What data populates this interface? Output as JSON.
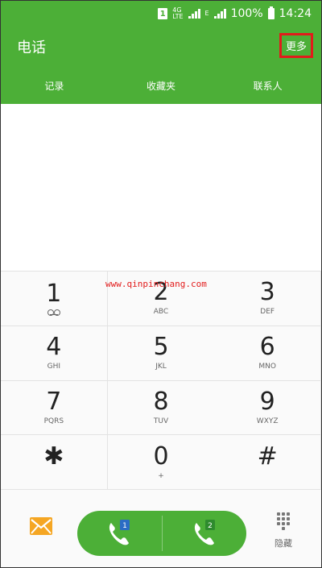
{
  "status": {
    "sim_slot": "1",
    "net_type": "4G",
    "net_sub": "LTE",
    "net_e": "E",
    "battery": "100%",
    "time": "14:24"
  },
  "appbar": {
    "title": "电话",
    "more": "更多"
  },
  "tabs": [
    {
      "label": "记录"
    },
    {
      "label": "收藏夹"
    },
    {
      "label": "联系人"
    }
  ],
  "watermark": "www.qinpinchang.com",
  "keys": [
    {
      "digit": "1",
      "sub": ""
    },
    {
      "digit": "2",
      "sub": "ABC"
    },
    {
      "digit": "3",
      "sub": "DEF"
    },
    {
      "digit": "4",
      "sub": "GHI"
    },
    {
      "digit": "5",
      "sub": "JKL"
    },
    {
      "digit": "6",
      "sub": "MNO"
    },
    {
      "digit": "7",
      "sub": "PQRS"
    },
    {
      "digit": "8",
      "sub": "TUV"
    },
    {
      "digit": "9",
      "sub": "WXYZ"
    },
    {
      "digit": "✱",
      "sub": ""
    },
    {
      "digit": "0",
      "sub": "+"
    },
    {
      "digit": "#",
      "sub": ""
    }
  ],
  "bottom": {
    "call1_badge": "1",
    "call2_badge": "2",
    "hide_label": "隐藏"
  },
  "colors": {
    "primary": "#4caf37",
    "accent_orange": "#f5a623",
    "highlight_red": "#e21b1b"
  },
  "icons": {
    "message": "message-icon",
    "call": "phone-icon",
    "dialpad": "dialpad-icon",
    "voicemail": "voicemail-icon"
  }
}
